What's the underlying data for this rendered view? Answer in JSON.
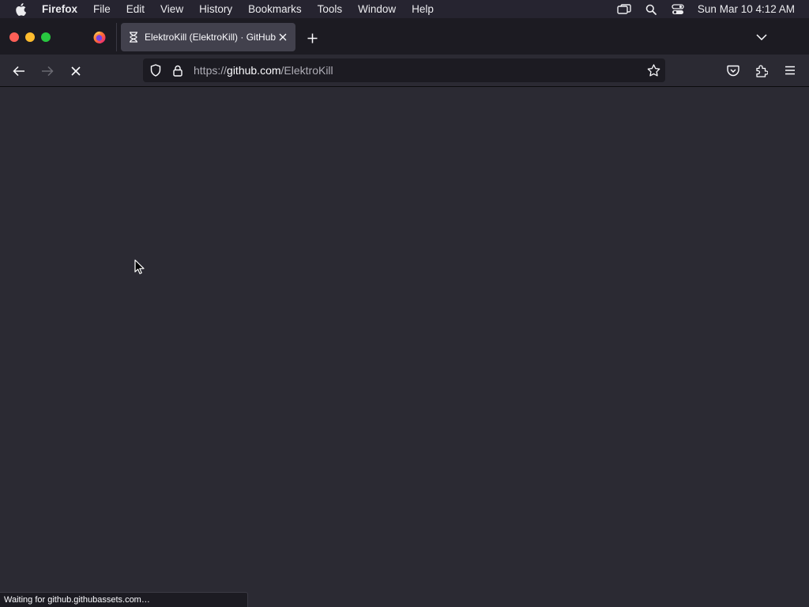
{
  "menubar": {
    "apple_icon": "apple-logo-icon",
    "items": [
      "Firefox",
      "File",
      "Edit",
      "View",
      "History",
      "Bookmarks",
      "Tools",
      "Window",
      "Help"
    ],
    "status_icons": [
      "screen-mirroring-icon",
      "spotlight-search-icon",
      "control-center-icon"
    ],
    "clock": "Sun Mar 10  4:12 AM"
  },
  "tabs": {
    "pinned_icon": "firefox-icon",
    "active_title": "ElektroKill (ElektroKill) · GitHub",
    "active_icon": "hourglass-loading-icon",
    "close_icon": "close-icon",
    "new_tab_icon": "plus-icon",
    "list_all_icon": "chevron-down-icon"
  },
  "navigation": {
    "back_icon": "arrow-left-icon",
    "forward_icon": "arrow-right-icon",
    "stop_icon": "stop-x-icon"
  },
  "urlbar": {
    "url_scheme": "https://",
    "url_host": "github.com",
    "url_path": "/ElektroKill",
    "tracking_icon": "shield-icon",
    "lock_icon": "lock-icon",
    "bookmark_icon": "star-icon"
  },
  "toolbar": {
    "icons": [
      "pocket-icon",
      "extensions-icon",
      "hamburger-menu-icon"
    ]
  },
  "status": {
    "text": "Waiting for github.githubassets.com…"
  },
  "colors": {
    "chrome_dark": "#1c1b22",
    "toolbar": "#2b2a33",
    "active_tab": "#42414d",
    "text": "#fbfbfe",
    "traffic_close": "#fe5f57",
    "traffic_min": "#febc2e",
    "traffic_max": "#28c840"
  }
}
